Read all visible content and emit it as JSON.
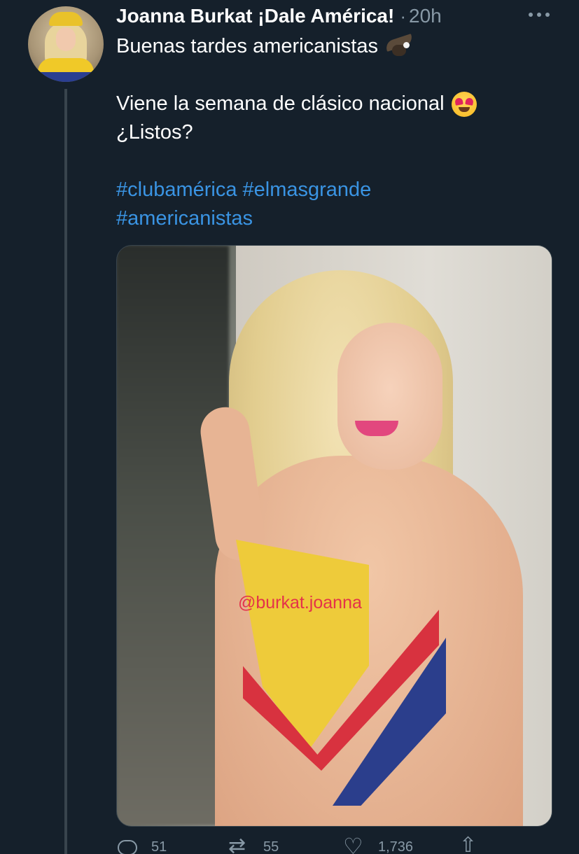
{
  "tweet": {
    "author_name": "Joanna Burkat ¡Dale América!",
    "separator": "·",
    "time": "20h",
    "text_lines": [
      "Buenas tardes americanistas",
      "Viene la semana de clásico nacional",
      "¿Listos?"
    ],
    "hashtags_line1": "#clubamérica #elmasgrande",
    "hashtags_line2": "#americanistas",
    "emoji_1": "eagle",
    "emoji_2": "smiling-face-with-heart-eyes",
    "media_watermark": "@burkat.joanna"
  },
  "actions": {
    "replies": "51",
    "retweets": "55",
    "likes": "1,736"
  },
  "colors": {
    "background": "#15202b",
    "text": "#ffffff",
    "muted": "#8899a6",
    "link": "#3a94e3"
  }
}
